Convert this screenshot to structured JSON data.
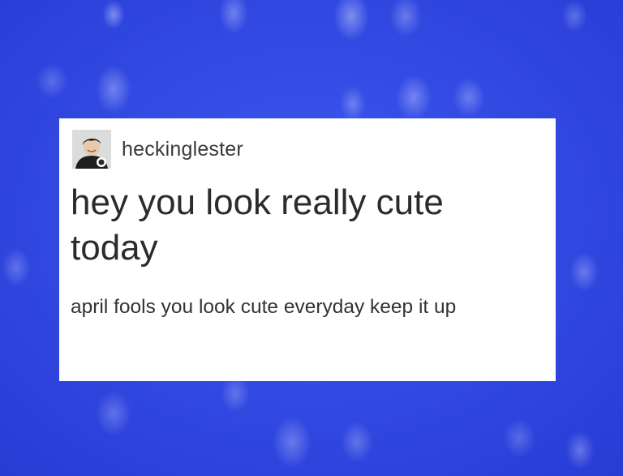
{
  "post": {
    "author": {
      "username": "heckinglester",
      "avatar_icon": "user-avatar-photo"
    },
    "title": "hey you look really cute today",
    "body": "april fools you look cute everyday keep it up"
  },
  "colors": {
    "background": "#2a3fd8",
    "card": "#ffffff",
    "text": "#2b2b2b"
  }
}
